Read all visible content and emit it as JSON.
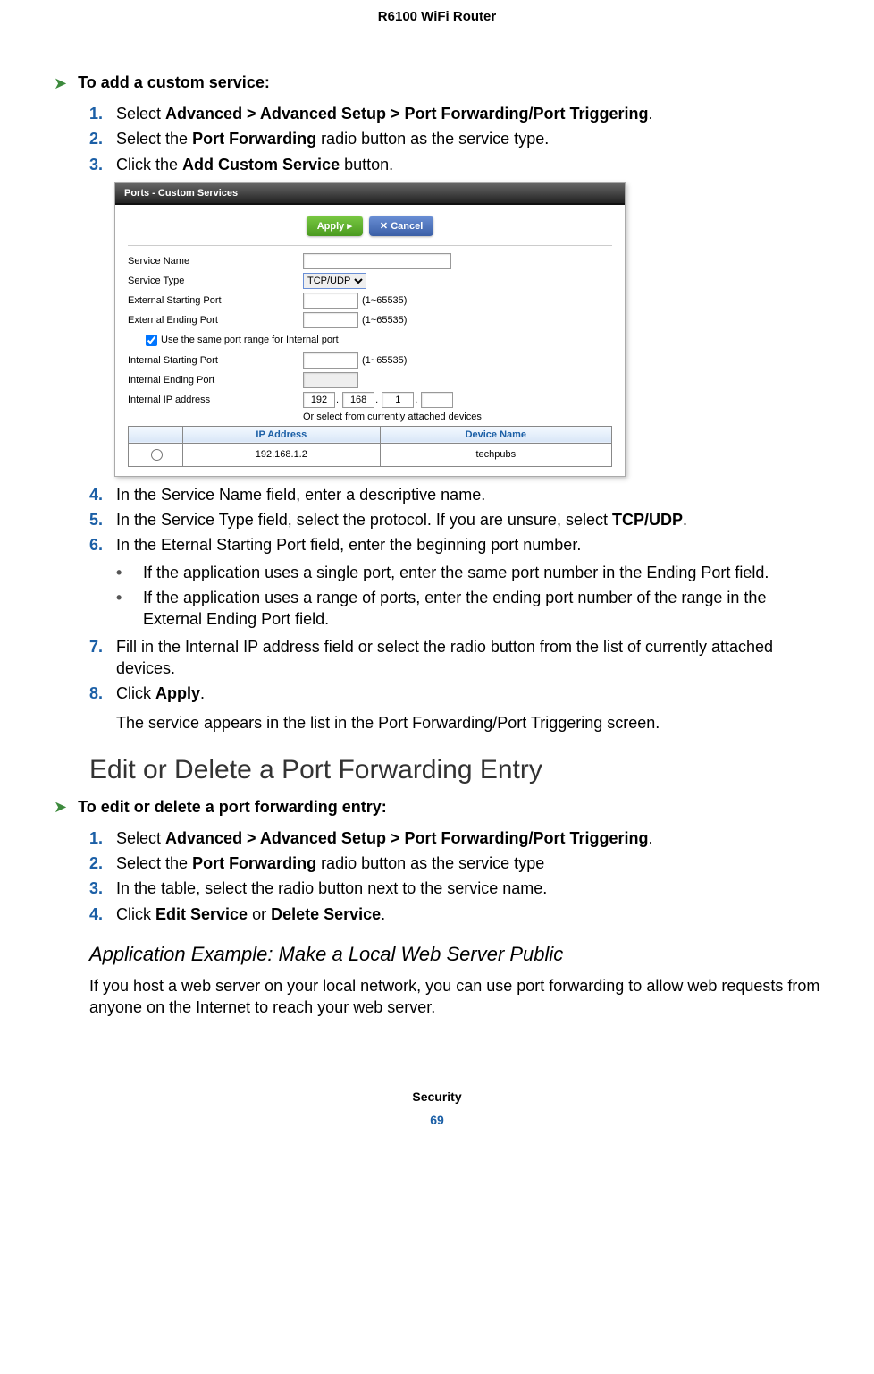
{
  "header": "R6100 WiFi Router",
  "proc1_title": "To add a custom service:",
  "step1a_pre": "Select ",
  "step1a_bold": "Advanced > Advanced Setup > Port Forwarding/Port Triggering",
  "step1a_post": ".",
  "step2a_pre": "Select the ",
  "step2a_bold": "Port Forwarding",
  "step2a_post": " radio button as the service type.",
  "step3a_pre": "Click the ",
  "step3a_bold": "Add Custom Service",
  "step3a_post": " button.",
  "step4a": "In the Service Name field, enter a descriptive name.",
  "step5a_pre": "In the Service Type field, select the protocol. If you are unsure, select ",
  "step5a_bold": "TCP/UDP",
  "step5a_post": ".",
  "step6a": "In the Eternal Starting Port field, enter the beginning port number.",
  "bullet1": "If the application uses a single port, enter the same port number in the Ending Port field.",
  "bullet2": "If the application uses a range of ports, enter the ending port number of the range in the External Ending Port field.",
  "step7a": "Fill in the Internal IP address field or select the radio button from the list of currently attached devices.",
  "step8a_pre": "Click ",
  "step8a_bold": "Apply",
  "step8a_post": ".",
  "step8a_note": "The service appears in the list in the Port Forwarding/Port Triggering screen.",
  "section_h2": "Edit or Delete a Port Forwarding Entry",
  "proc2_title": "To edit or delete a port forwarding entry:",
  "step1b_pre": "Select ",
  "step1b_bold": "Advanced > Advanced Setup > Port Forwarding/Port Triggering",
  "step1b_post": ".",
  "step2b_pre": "Select the ",
  "step2b_bold": "Port Forwarding",
  "step2b_post": " radio button as the service type",
  "step3b": "In the table, select the radio button next to the service name.",
  "step4b_pre": "Click ",
  "step4b_bold1": "Edit Service",
  "step4b_mid": " or ",
  "step4b_bold2": "Delete Service",
  "step4b_post": ".",
  "subsection": "Application Example: Make a Local Web Server Public",
  "subpara": "If you host a web server on your local network, you can use port forwarding to allow web requests from anyone on the Internet to reach your web server.",
  "footer_chapter": "Security",
  "footer_page": "69",
  "screenshot": {
    "title": "Ports - Custom Services",
    "apply": "Apply ▸",
    "cancel": "✕ Cancel",
    "service_name": "Service Name",
    "service_type": "Service Type",
    "service_type_value": "TCP/UDP",
    "ext_start": "External Starting Port",
    "ext_end": "External Ending Port",
    "range_hint": "(1~65535)",
    "checkbox": "Use the same port range for Internal port",
    "int_start": "Internal Starting Port",
    "int_end": "Internal Ending Port",
    "int_ip": "Internal IP address",
    "ip1": "192",
    "ip2": "168",
    "ip3": "1",
    "ip4": "",
    "orselect": "Or select from currently attached devices",
    "th_ip": "IP Address",
    "th_dev": "Device Name",
    "row_ip": "192.168.1.2",
    "row_dev": "techpubs"
  }
}
